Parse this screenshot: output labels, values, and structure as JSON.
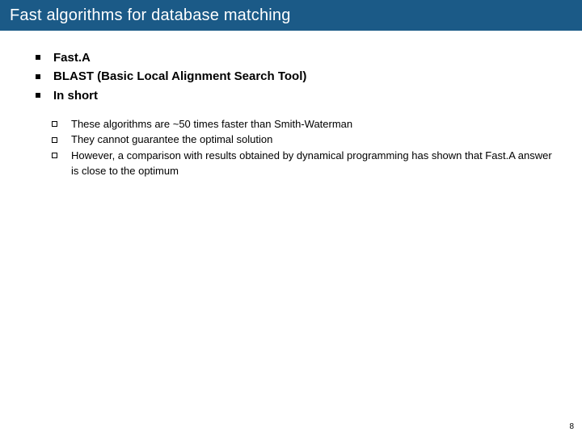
{
  "title": "Fast algorithms for database matching",
  "bullets_lvl1": [
    "Fast.A",
    "BLAST (Basic Local Alignment Search Tool)",
    "In short"
  ],
  "bullets_lvl2": [
    "These algorithms are ~50 times faster than Smith-Waterman",
    "They cannot guarantee the optimal solution",
    "However, a comparison with results obtained by dynamical programming has shown that Fast.A answer is close to the optimum"
  ],
  "page_number": "8"
}
